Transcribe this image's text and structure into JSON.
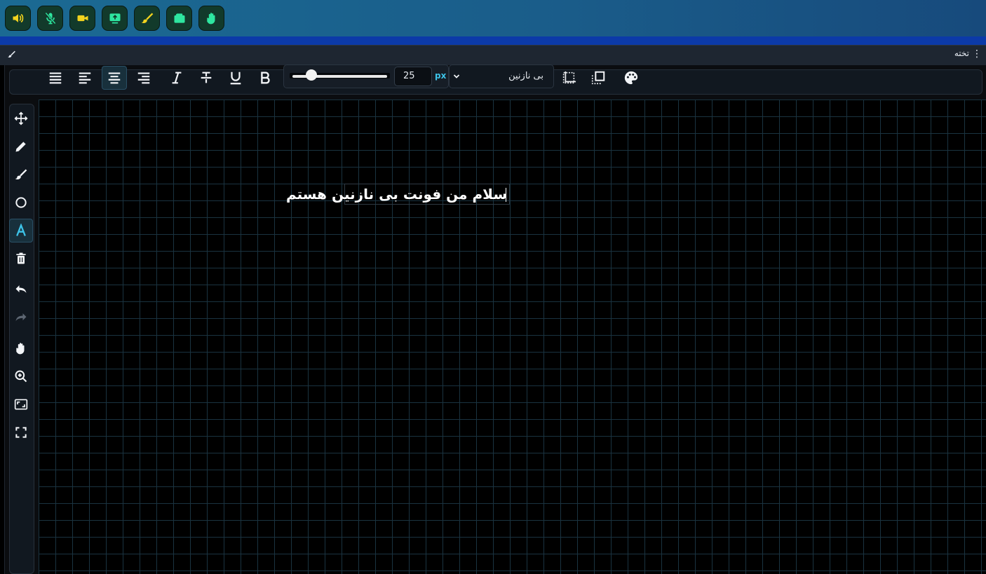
{
  "panel": {
    "title": "تخته"
  },
  "top_buttons": [
    {
      "name": "volume-icon",
      "color": "#f1d21e"
    },
    {
      "name": "microphone-off-icon",
      "color": "#2ee6a0"
    },
    {
      "name": "video-camera-icon",
      "color": "#f1d21e"
    },
    {
      "name": "screen-share-icon",
      "color": "#2ee6a0"
    },
    {
      "name": "paint-brush-icon",
      "color": "#f1d21e"
    },
    {
      "name": "folder-icon",
      "color": "#2ee6a0"
    },
    {
      "name": "raise-hand-icon",
      "color": "#2ee6a0"
    }
  ],
  "toolbar": {
    "align_buttons": [
      "align-justify-icon",
      "align-left-icon",
      "align-center-icon",
      "align-right-icon"
    ],
    "active_align": "align-center-icon",
    "style_buttons": [
      "italic-icon",
      "strikethrough-icon",
      "underline-icon",
      "bold-icon"
    ],
    "font_size": {
      "value": "25",
      "unit": "px",
      "slider_fraction": 0.2
    },
    "font_family": "بی نازنین",
    "extra_buttons": [
      "select-dotted-icon",
      "select-solid-icon",
      "palette-icon"
    ]
  },
  "sidebar_tools": [
    {
      "name": "move-tool-icon",
      "active": false
    },
    {
      "name": "pencil-tool-icon",
      "active": false
    },
    {
      "name": "brush-tool-icon",
      "active": false
    },
    {
      "name": "circle-tool-icon",
      "active": false
    },
    {
      "name": "text-tool-icon",
      "active": true
    },
    {
      "name": "trash-icon",
      "active": false
    },
    {
      "name": "undo-icon",
      "active": false
    },
    {
      "name": "redo-icon",
      "active": false
    },
    {
      "name": "hand-pan-icon",
      "active": false
    },
    {
      "name": "zoom-in-icon",
      "active": false
    },
    {
      "name": "fit-screen-icon",
      "active": false
    },
    {
      "name": "fullscreen-icon",
      "active": false
    }
  ],
  "canvas": {
    "text": "سلام من فونت بی نازنین هستم",
    "grid_color": "#1a3340",
    "accent": "#3dc3e8"
  }
}
